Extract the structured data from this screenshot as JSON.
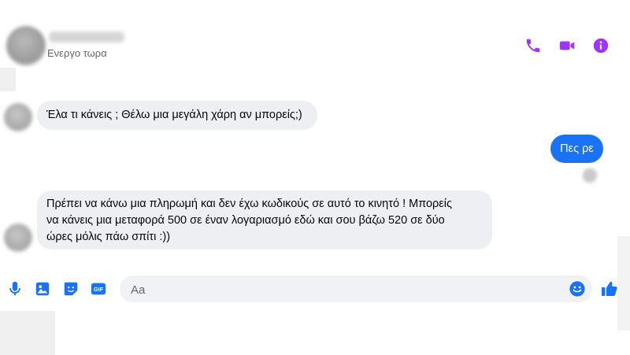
{
  "header": {
    "status": "Ενεργο τωρα",
    "actions": [
      {
        "name": "phone-icon",
        "color": "#a033ff"
      },
      {
        "name": "video-camera-icon",
        "color": "#a033ff"
      },
      {
        "name": "info-icon",
        "color": "#a033ff"
      }
    ]
  },
  "messages": [
    {
      "direction": "incoming",
      "text": "Έλα τι κάνεις ; Θέλω μια μεγάλη χάρη αν μπορείς;)"
    },
    {
      "direction": "outgoing",
      "text": "Πες ρε"
    },
    {
      "direction": "incoming",
      "lines": [
        "Πρέπει να κάνω μια πληρωμή και δεν έχω κωδικούς σε αυτό το κινητό ! Μπορείς",
        "να κάνεις μια μεταφορά 500 σε έναν λογαριασμό εδώ και σου βάζω 520 σε δύο",
        "ώρες μόλις πάω σπίτι :))"
      ]
    }
  ],
  "composer": {
    "placeholder": "Aa",
    "left_icons": [
      "microphone-icon",
      "image-icon",
      "sticker-icon",
      "gif-icon"
    ],
    "gif_label": "GIF",
    "emoji_icon": "emoji-icon",
    "send_icon": "thumbs-up-icon"
  },
  "colors": {
    "accent": "#a033ff",
    "outgoing_bubble": "#1a73f5",
    "incoming_bubble": "#eeeff2",
    "composer_icons": "#1a73f5"
  }
}
